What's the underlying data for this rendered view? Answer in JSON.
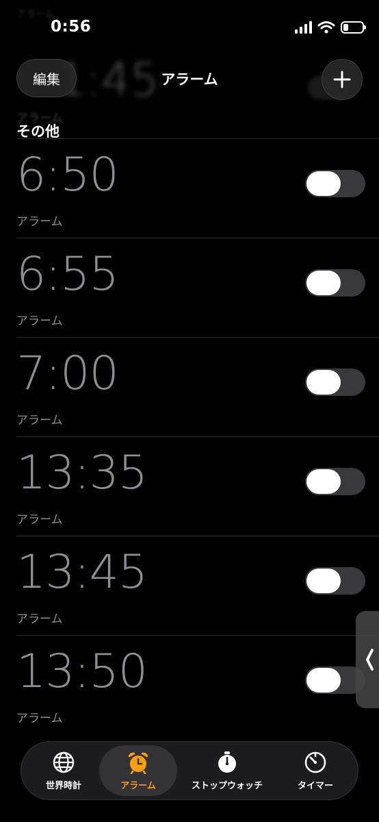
{
  "status_bar": {
    "time": "0:56",
    "battery_level": 0.25
  },
  "background_header": {
    "top_label": "アラーム",
    "time": "1:45",
    "label": "アラーム"
  },
  "nav": {
    "edit_label": "編集",
    "title": "アラーム",
    "add_icon": "plus-icon"
  },
  "section": {
    "title": "その他"
  },
  "alarms": [
    {
      "time": "6:50",
      "label": "アラーム",
      "enabled": false
    },
    {
      "time": "6:55",
      "label": "アラーム",
      "enabled": false
    },
    {
      "time": "7:00",
      "label": "アラーム",
      "enabled": false
    },
    {
      "time": "13:35",
      "label": "アラーム",
      "enabled": false
    },
    {
      "time": "13:45",
      "label": "アラーム",
      "enabled": false
    },
    {
      "time": "13:50",
      "label": "アラーム",
      "enabled": false
    }
  ],
  "tabs": [
    {
      "label": "世界時計",
      "icon": "globe-icon",
      "active": false
    },
    {
      "label": "アラーム",
      "icon": "alarm-clock-icon",
      "active": true
    },
    {
      "label": "ストップウォッチ",
      "icon": "stopwatch-icon",
      "active": false
    },
    {
      "label": "タイマー",
      "icon": "timer-icon",
      "active": false
    }
  ],
  "colors": {
    "accent": "#ff9f0a",
    "background": "#000000",
    "text_secondary": "#8e8e93",
    "toggle_off": "#39393d"
  }
}
